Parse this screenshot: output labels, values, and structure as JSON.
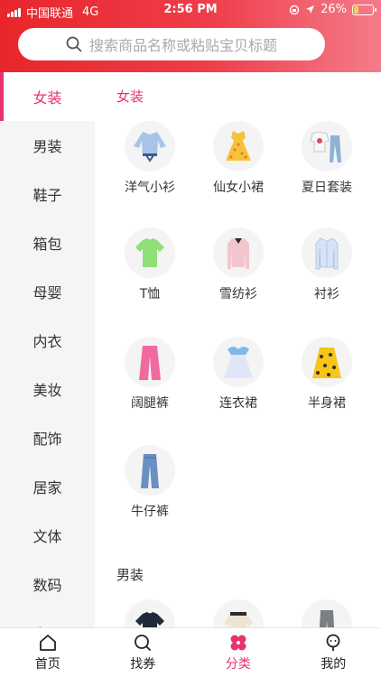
{
  "status": {
    "carrier": "中国联通",
    "network": "4G",
    "time": "2:56 PM",
    "battery": "26%",
    "battery_level": 0.26
  },
  "search": {
    "placeholder": "搜索商品名称或粘贴宝贝标题",
    "icon": "search-icon"
  },
  "sidebar": {
    "items": [
      {
        "label": "女装",
        "active": true
      },
      {
        "label": "男装"
      },
      {
        "label": "鞋子"
      },
      {
        "label": "箱包"
      },
      {
        "label": "母婴"
      },
      {
        "label": "内衣"
      },
      {
        "label": "美妆"
      },
      {
        "label": "配饰"
      },
      {
        "label": "居家"
      },
      {
        "label": "文体"
      },
      {
        "label": "数码"
      },
      {
        "label": "电器"
      }
    ]
  },
  "main": {
    "sections": [
      {
        "title": "女装",
        "items": [
          {
            "label": "洋气小衫",
            "icon": "blouse-icon"
          },
          {
            "label": "仙女小裙",
            "icon": "dress-icon"
          },
          {
            "label": "夏日套装",
            "icon": "outfit-icon"
          },
          {
            "label": "T恤",
            "icon": "tshirt-icon"
          },
          {
            "label": "雪纺衫",
            "icon": "chiffon-shirt-icon"
          },
          {
            "label": "衬衫",
            "icon": "shirt-icon"
          },
          {
            "label": "阔腿裤",
            "icon": "wide-pants-icon"
          },
          {
            "label": "连衣裙",
            "icon": "one-piece-dress-icon"
          },
          {
            "label": "半身裙",
            "icon": "skirt-icon"
          },
          {
            "label": "牛仔裤",
            "icon": "jeans-icon"
          }
        ]
      },
      {
        "title": "男装",
        "items": [
          {
            "icon": "mens-tshirt-icon"
          },
          {
            "icon": "mens-sweater-icon"
          },
          {
            "icon": "mens-pants-icon"
          }
        ]
      }
    ]
  },
  "tabbar": {
    "tabs": [
      {
        "label": "首页",
        "icon": "home-icon"
      },
      {
        "label": "找券",
        "icon": "coupon-search-icon"
      },
      {
        "label": "分类",
        "icon": "category-icon",
        "active": true
      },
      {
        "label": "我的",
        "icon": "profile-icon"
      }
    ]
  },
  "colors": {
    "header_start": "#e8262b",
    "header_end": "#f47c8a",
    "accent": "#e8336a",
    "sidebar_bg": "#f5f5f5"
  }
}
